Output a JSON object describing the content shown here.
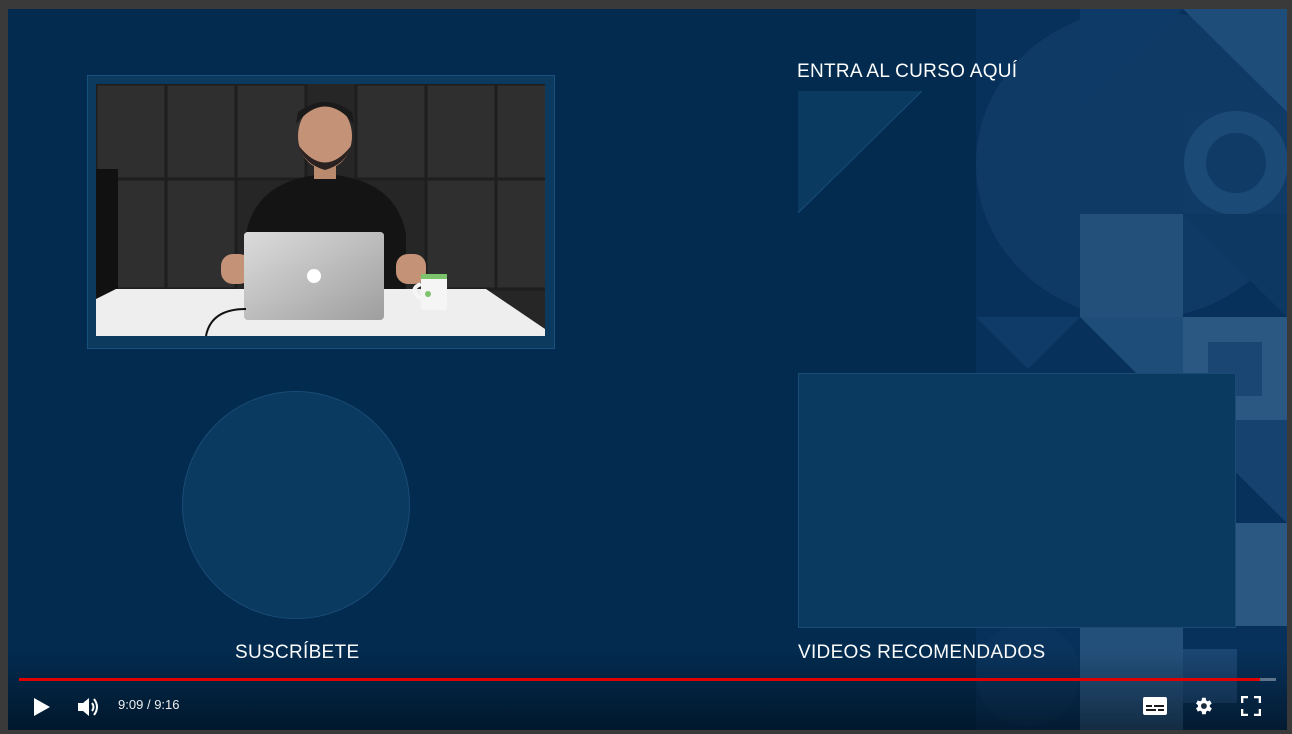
{
  "end_screen": {
    "course_label": "ENTRA AL CURSO AQUÍ",
    "subscribe_label": "SUSCRÍBETE",
    "recommended_label": "VIDEOS RECOMENDADOS"
  },
  "player": {
    "current_time": "9:09",
    "separator": "/",
    "duration": "9:16",
    "progress": 0.987,
    "progress_color": "#e00000"
  },
  "controls": {
    "play_icon": "play-icon",
    "volume_icon": "volume-icon",
    "subtitles_icon": "subtitles-icon",
    "settings_icon": "settings-gear-icon",
    "fullscreen_icon": "fullscreen-icon"
  },
  "colors": {
    "background": "#022b4f",
    "accent": "#e00000"
  }
}
